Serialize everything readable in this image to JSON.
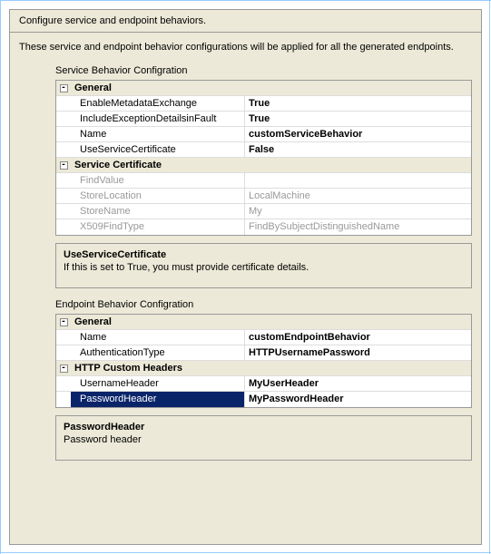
{
  "title": "Configure service and endpoint behaviors.",
  "intro": "These service and endpoint behavior configurations will be applied for all the generated endpoints.",
  "serviceBehavior": {
    "sectionTitle": "Service Behavior Configration",
    "groups": [
      {
        "name": "General",
        "expanded": true,
        "rows": [
          {
            "name": "EnableMetadataExchange",
            "value": "True",
            "bold": true
          },
          {
            "name": "IncludeExceptionDetailsinFault",
            "value": "True",
            "bold": true
          },
          {
            "name": "Name",
            "value": "customServiceBehavior",
            "bold": true
          },
          {
            "name": "UseServiceCertificate",
            "value": "False",
            "bold": true
          }
        ]
      },
      {
        "name": "Service Certificate",
        "expanded": true,
        "rows": [
          {
            "name": "FindValue",
            "value": "",
            "disabled": true
          },
          {
            "name": "StoreLocation",
            "value": "LocalMachine",
            "disabled": true
          },
          {
            "name": "StoreName",
            "value": "My",
            "disabled": true
          },
          {
            "name": "X509FindType",
            "value": "FindBySubjectDistinguishedName",
            "disabled": true
          }
        ]
      }
    ],
    "desc": {
      "title": "UseServiceCertificate",
      "text": "If this is set to True, you must provide certificate details."
    }
  },
  "endpointBehavior": {
    "sectionTitle": "Endpoint Behavior Configration",
    "groups": [
      {
        "name": "General",
        "expanded": true,
        "rows": [
          {
            "name": "Name",
            "value": "customEndpointBehavior",
            "bold": true
          },
          {
            "name": "AuthenticationType",
            "value": "HTTPUsernamePassword",
            "bold": true
          }
        ]
      },
      {
        "name": "HTTP Custom Headers",
        "expanded": true,
        "rows": [
          {
            "name": "UsernameHeader",
            "value": "MyUserHeader",
            "bold": true
          },
          {
            "name": "PasswordHeader",
            "value": "MyPasswordHeader",
            "bold": true,
            "selected": true
          }
        ]
      }
    ],
    "desc": {
      "title": "PasswordHeader",
      "text": "Password header"
    }
  }
}
